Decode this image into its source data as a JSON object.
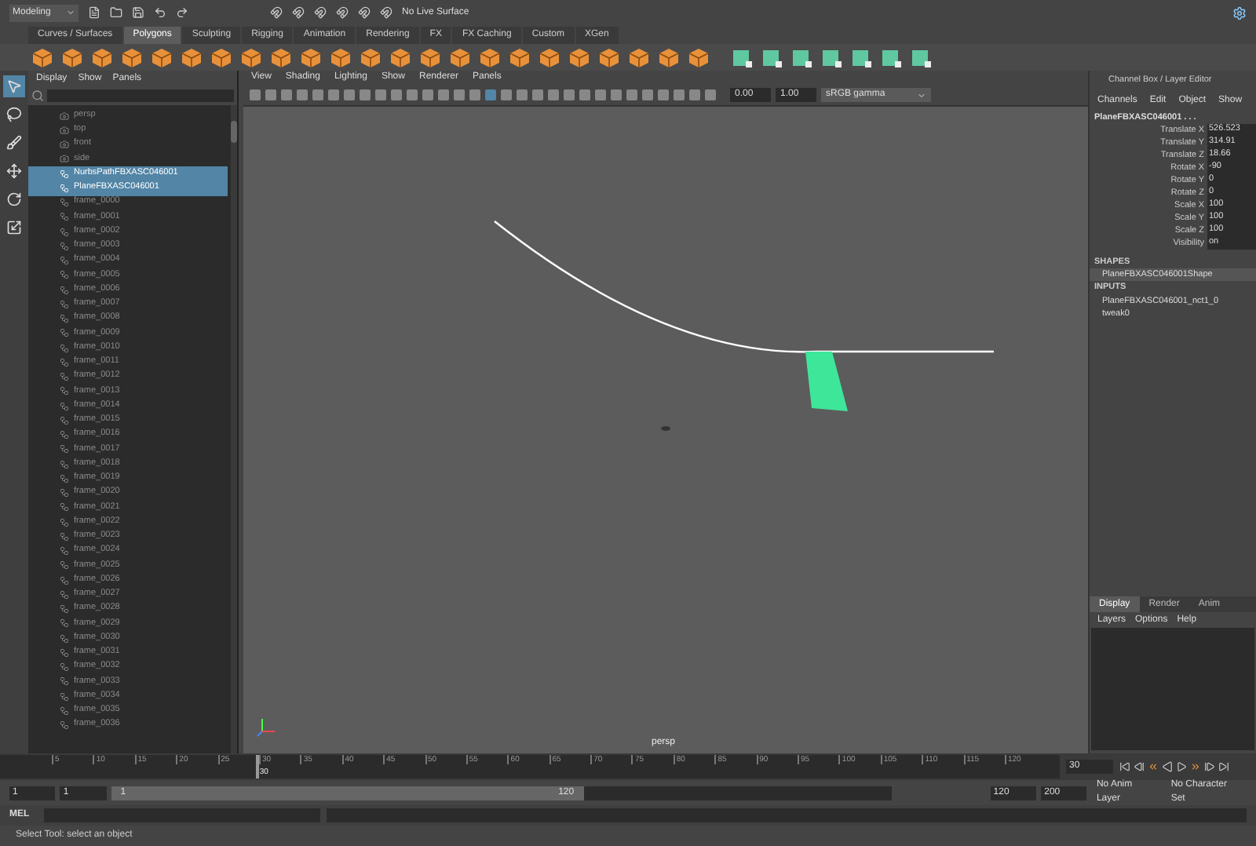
{
  "status_line": {
    "mode": "Modeling",
    "live_surface": "No Live Surface"
  },
  "shelf_tabs": [
    {
      "label": "Curves / Surfaces",
      "selected": false
    },
    {
      "label": "Polygons",
      "selected": true
    },
    {
      "label": "Sculpting",
      "selected": false
    },
    {
      "label": "Rigging",
      "selected": false
    },
    {
      "label": "Animation",
      "selected": false
    },
    {
      "label": "Rendering",
      "selected": false
    },
    {
      "label": "FX",
      "selected": false
    },
    {
      "label": "FX Caching",
      "selected": false
    },
    {
      "label": "Custom",
      "selected": false
    },
    {
      "label": "XGen",
      "selected": false
    }
  ],
  "toolbox": [
    {
      "kind": "select",
      "selected": true
    },
    {
      "kind": "lasso",
      "selected": false
    },
    {
      "kind": "paint",
      "selected": false
    },
    {
      "kind": "move",
      "selected": false
    },
    {
      "kind": "rotate",
      "selected": false
    },
    {
      "kind": "scale",
      "selected": false
    }
  ],
  "outliner": {
    "menu": [
      "Display",
      "Show",
      "Panels"
    ],
    "items": [
      {
        "label": "persp",
        "kind": "camera",
        "selected": false
      },
      {
        "label": "top",
        "kind": "camera",
        "selected": false
      },
      {
        "label": "front",
        "kind": "camera",
        "selected": false
      },
      {
        "label": "side",
        "kind": "camera",
        "selected": false
      },
      {
        "label": "NurbsPathFBXASC046001",
        "kind": "node",
        "selected": true
      },
      {
        "label": "PlaneFBXASC046001",
        "kind": "node",
        "selected": true
      },
      {
        "label": "frame_0000",
        "kind": "node",
        "selected": false
      },
      {
        "label": "frame_0001",
        "kind": "node",
        "selected": false
      },
      {
        "label": "frame_0002",
        "kind": "node",
        "selected": false
      },
      {
        "label": "frame_0003",
        "kind": "node",
        "selected": false
      },
      {
        "label": "frame_0004",
        "kind": "node",
        "selected": false
      },
      {
        "label": "frame_0005",
        "kind": "node",
        "selected": false
      },
      {
        "label": "frame_0006",
        "kind": "node",
        "selected": false
      },
      {
        "label": "frame_0007",
        "kind": "node",
        "selected": false
      },
      {
        "label": "frame_0008",
        "kind": "node",
        "selected": false
      },
      {
        "label": "frame_0009",
        "kind": "node",
        "selected": false
      },
      {
        "label": "frame_0010",
        "kind": "node",
        "selected": false
      },
      {
        "label": "frame_0011",
        "kind": "node",
        "selected": false
      },
      {
        "label": "frame_0012",
        "kind": "node",
        "selected": false
      },
      {
        "label": "frame_0013",
        "kind": "node",
        "selected": false
      },
      {
        "label": "frame_0014",
        "kind": "node",
        "selected": false
      },
      {
        "label": "frame_0015",
        "kind": "node",
        "selected": false
      },
      {
        "label": "frame_0016",
        "kind": "node",
        "selected": false
      },
      {
        "label": "frame_0017",
        "kind": "node",
        "selected": false
      },
      {
        "label": "frame_0018",
        "kind": "node",
        "selected": false
      },
      {
        "label": "frame_0019",
        "kind": "node",
        "selected": false
      },
      {
        "label": "frame_0020",
        "kind": "node",
        "selected": false
      },
      {
        "label": "frame_0021",
        "kind": "node",
        "selected": false
      },
      {
        "label": "frame_0022",
        "kind": "node",
        "selected": false
      },
      {
        "label": "frame_0023",
        "kind": "node",
        "selected": false
      },
      {
        "label": "frame_0024",
        "kind": "node",
        "selected": false
      },
      {
        "label": "frame_0025",
        "kind": "node",
        "selected": false
      },
      {
        "label": "frame_0026",
        "kind": "node",
        "selected": false
      },
      {
        "label": "frame_0027",
        "kind": "node",
        "selected": false
      },
      {
        "label": "frame_0028",
        "kind": "node",
        "selected": false
      },
      {
        "label": "frame_0029",
        "kind": "node",
        "selected": false
      },
      {
        "label": "frame_0030",
        "kind": "node",
        "selected": false
      },
      {
        "label": "frame_0031",
        "kind": "node",
        "selected": false
      },
      {
        "label": "frame_0032",
        "kind": "node",
        "selected": false
      },
      {
        "label": "frame_0033",
        "kind": "node",
        "selected": false
      },
      {
        "label": "frame_0034",
        "kind": "node",
        "selected": false
      },
      {
        "label": "frame_0035",
        "kind": "node",
        "selected": false
      },
      {
        "label": "frame_0036",
        "kind": "node",
        "selected": false
      }
    ]
  },
  "viewport": {
    "menu": [
      "View",
      "Shading",
      "Lighting",
      "Show",
      "Renderer",
      "Panels"
    ],
    "exposure": "0.00",
    "gamma": "1.00",
    "color_space": "sRGB gamma",
    "camera": "persp"
  },
  "channel_box": {
    "title": "Channel Box / Layer Editor",
    "menu": [
      "Channels",
      "Edit",
      "Object",
      "Show"
    ],
    "object": "PlaneFBXASC046001 . . .",
    "attributes": [
      {
        "name": "Translate X",
        "value": "526.523"
      },
      {
        "name": "Translate Y",
        "value": "314.91"
      },
      {
        "name": "Translate Z",
        "value": "18.66"
      },
      {
        "name": "Rotate X",
        "value": "-90"
      },
      {
        "name": "Rotate Y",
        "value": "0"
      },
      {
        "name": "Rotate Z",
        "value": "0"
      },
      {
        "name": "Scale X",
        "value": "100"
      },
      {
        "name": "Scale Y",
        "value": "100"
      },
      {
        "name": "Scale Z",
        "value": "100"
      },
      {
        "name": "Visibility",
        "value": "on"
      }
    ],
    "shapes_heading": "SHAPES",
    "shapes": [
      "PlaneFBXASC046001Shape"
    ],
    "inputs_heading": "INPUTS",
    "inputs": [
      "PlaneFBXASC046001_nct1_0",
      "tweak0"
    ]
  },
  "layer_editor": {
    "tabs": [
      {
        "label": "Display",
        "selected": true
      },
      {
        "label": "Render",
        "selected": false
      },
      {
        "label": "Anim",
        "selected": false
      }
    ],
    "menu": [
      "Layers",
      "Options",
      "Help"
    ]
  },
  "timeline": {
    "ticks": [
      "5",
      "10",
      "15",
      "20",
      "25",
      "30",
      "35",
      "40",
      "45",
      "50",
      "55",
      "60",
      "65",
      "70",
      "75",
      "80",
      "85",
      "90",
      "95",
      "100",
      "105",
      "110",
      "115",
      "120"
    ],
    "playhead": {
      "label": "30",
      "level": 0.25
    },
    "current_frame": "30"
  },
  "range": {
    "start": "1",
    "playback_start": "1",
    "slider_start": "1",
    "slider_end": "120",
    "level": 0.59,
    "playback_end": "120",
    "end": "200",
    "anim_layer": "No Anim Layer",
    "character_set": "No Character Set"
  },
  "command_line": {
    "label": "MEL"
  },
  "help_line": "Select Tool: select an object"
}
